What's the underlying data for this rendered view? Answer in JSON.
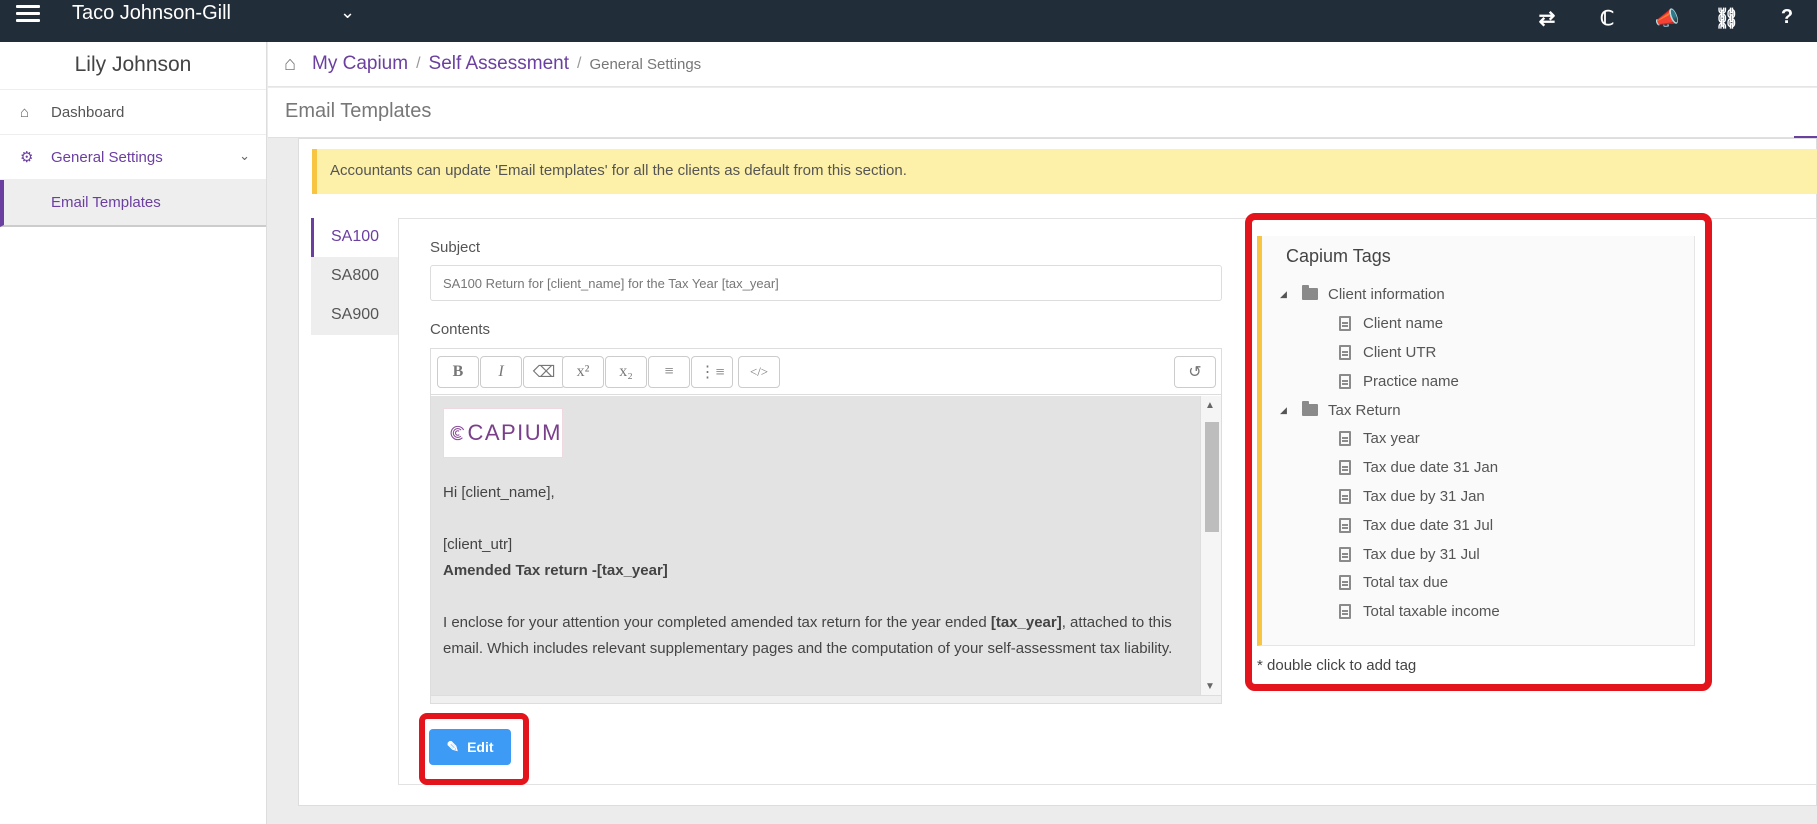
{
  "topbar": {
    "practice_name": "Taco Johnson-Gill",
    "icons": [
      "transfer-icon",
      "capium-icon",
      "announcement-icon",
      "ticket-icon",
      "help-icon"
    ]
  },
  "sidebar": {
    "user_name": "Lily Johnson",
    "items": [
      {
        "label": "Dashboard",
        "icon": "home-icon"
      },
      {
        "label": "General Settings",
        "icon": "cogs-icon"
      }
    ],
    "sub_items": [
      {
        "label": "Email Templates"
      }
    ]
  },
  "breadcrumb": {
    "items": [
      "My Capium",
      "Self Assessment"
    ],
    "current": "General Settings",
    "separator": "/"
  },
  "page": {
    "title": "Email Templates",
    "notice": "Accountants can update 'Email templates' for all the clients as default from this section."
  },
  "tabs": [
    {
      "label": "SA100",
      "active": true
    },
    {
      "label": "SA800",
      "active": false
    },
    {
      "label": "SA900",
      "active": false
    }
  ],
  "form": {
    "subject_label": "Subject",
    "subject_value": "SA100 Return for [client_name] for the Tax Year [tax_year]",
    "contents_label": "Contents"
  },
  "toolbar": {
    "bold": "B",
    "italic": "I",
    "superscript": "x²",
    "subscript": "x₂"
  },
  "email_body": {
    "logo_text": "CAPIUM",
    "greeting": "Hi [client_name],",
    "utr": "[client_utr]",
    "heading": "Amended Tax return -[tax_year]",
    "para_start": "I enclose for your attention your completed amended tax return for the year ended ",
    "para_tag": "[tax_year]",
    "para_end": ", attached to this email. Which includes relevant supplementary pages and the computation of your self-assessment tax liability."
  },
  "edit_button": {
    "label": "Edit"
  },
  "tags": {
    "title": "Capium Tags",
    "groups": [
      {
        "label": "Client information",
        "items": [
          "Client name",
          "Client UTR",
          "Practice name"
        ]
      },
      {
        "label": "Tax Return",
        "items": [
          "Tax year",
          "Tax due date 31 Jan",
          "Tax due by 31 Jan",
          "Tax due date 31 Jul",
          "Tax due by 31 Jul",
          "Total tax due",
          "Total taxable income"
        ]
      }
    ],
    "hint": "* double click to add tag"
  },
  "colors": {
    "topbar": "#222d3a",
    "accent": "#6b3fa0",
    "notice_bg": "#fdf0a8",
    "notice_border": "#f7c542",
    "highlight": "#e3141b",
    "edit_button": "#3d9bf5"
  }
}
